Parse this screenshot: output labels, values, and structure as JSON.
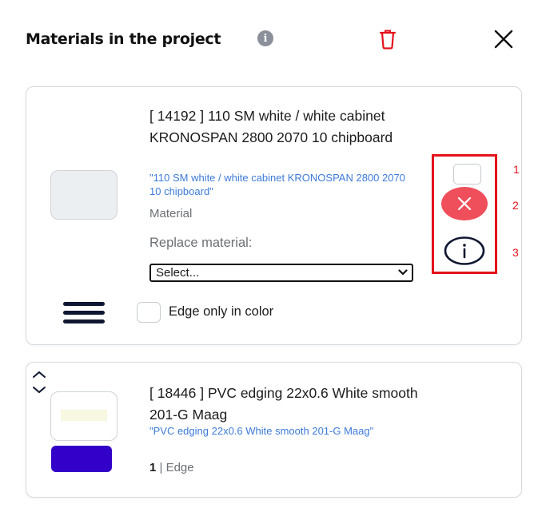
{
  "header": {
    "title": "Materials in the project",
    "info_glyph": "i",
    "icons": [
      "info-icon",
      "trash-icon",
      "close-icon"
    ]
  },
  "materials": [
    {
      "title": "[ 14192 ] 110 SM white / white cabinet KRONOSPAN 2800 2070 10 chipboard",
      "subtitle": "\"110 SM white / white cabinet KRONOSPAN 2800 2070 10 chipboard\"",
      "type": "Material",
      "replace_label": "Replace material:",
      "select_value": "Select...",
      "edge_only_label": "Edge only in color",
      "edge_only_checked": false,
      "selected": false
    },
    {
      "title": "[ 18446 ] PVC edging 22x0.6 White smooth 201-G Maag",
      "subtitle": "\"PVC edging 22x0.6 White smooth 201-G Maag\"",
      "quantity": "1",
      "separator": " | ",
      "type": "Edge",
      "edge_color": "#3200c8"
    }
  ],
  "annotations": [
    "1",
    "2",
    "3"
  ],
  "colors": {
    "accent_red": "#e3131b",
    "remove_button": "#ef4f5b",
    "link_blue": "#3d7bd9",
    "edge_swatch": "#3200c8"
  }
}
